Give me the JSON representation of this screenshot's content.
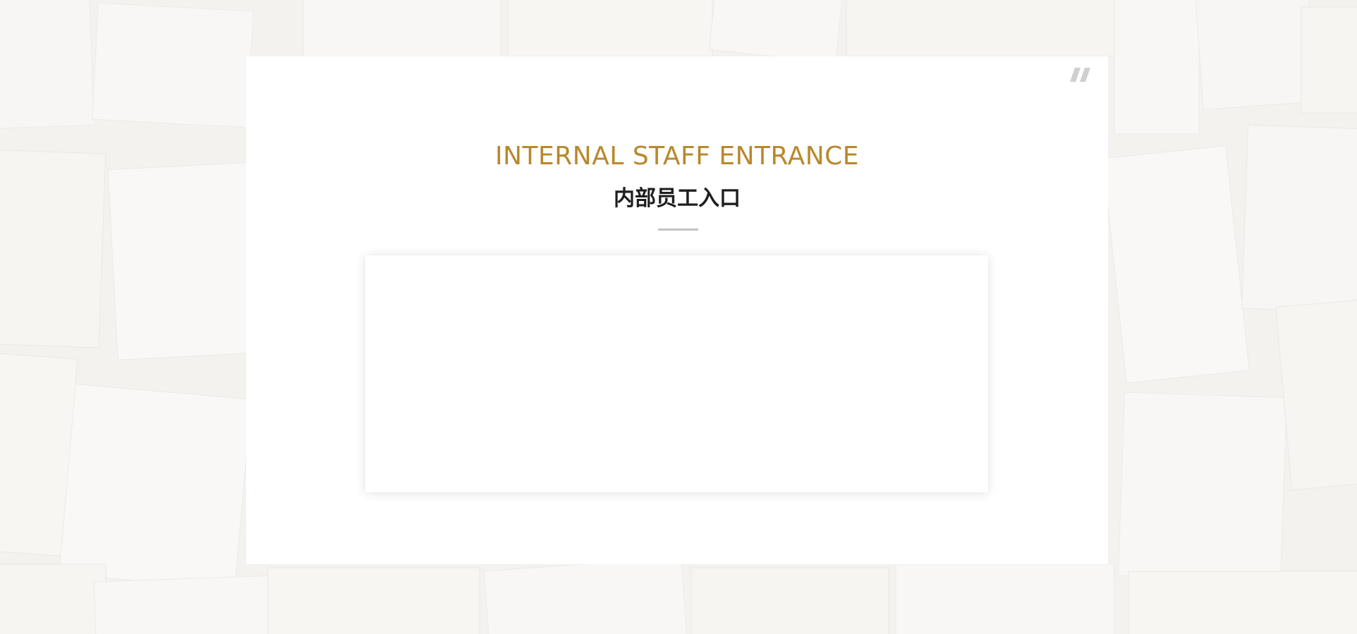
{
  "header": {
    "title_en": "INTERNAL STAFF ENTRANCE",
    "title_zh": "内部员工入口"
  },
  "icons": {
    "quote": "quote-icon"
  },
  "colors": {
    "accent": "#b8882c",
    "background": "#f4f3f1",
    "card": "#ffffff",
    "divider": "#c3c3c3",
    "quote_mark": "#cfcfcf"
  },
  "content_panel": {
    "state": "empty"
  }
}
